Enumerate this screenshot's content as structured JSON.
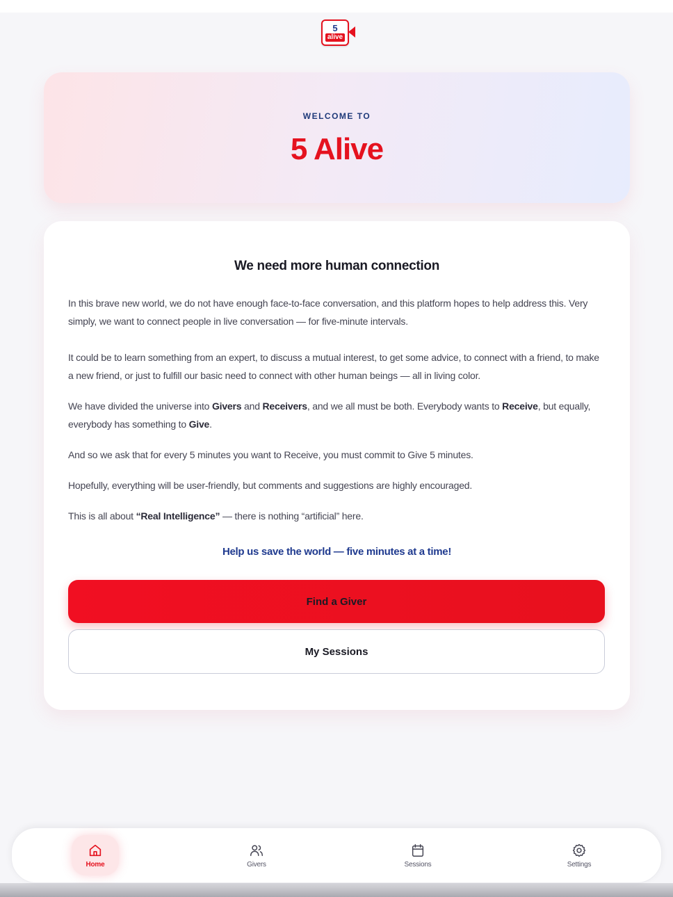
{
  "logo": {
    "number": "5",
    "word": "alive"
  },
  "hero": {
    "eyebrow": "WELCOME TO",
    "title": "5 Alive"
  },
  "card": {
    "heading": "We need more human connection",
    "paragraphs": {
      "p1": "In this brave new world, we do not have enough face-to-face conversation, and this platform hopes to help address this.  Very simply, we want to connect people in live conversation — for five-minute intervals.",
      "p2": "It could be to learn something from an expert, to discuss a mutual interest, to get some advice, to connect with a friend, to make a new friend, or just to fulfill our basic need to connect with other human beings — all in living color.",
      "p3": {
        "a": "We have divided the universe into ",
        "givers": "Givers",
        "b": " and ",
        "receivers": "Receivers",
        "c": ", and we all must be both. Everybody wants to ",
        "receive": "Receive",
        "d": ", but equally, everybody has something to ",
        "give": "Give",
        "e": "."
      },
      "p4": "And so we ask that for every 5 minutes you want to Receive, you must commit to Give 5 minutes.",
      "p5": "Hopefully, everything will be user-friendly, but comments and suggestions are highly encouraged.",
      "p6": {
        "a": "This is all about ",
        "bold": "“Real Intelligence”",
        "b": " — there is nothing “artificial” here."
      }
    },
    "tagline": "Help us save the world — five minutes at a time!",
    "primary_button": "Find a Giver",
    "secondary_button": "My Sessions"
  },
  "nav": {
    "items": [
      {
        "label": "Home",
        "icon": "home-icon",
        "active": true
      },
      {
        "label": "Givers",
        "icon": "users-icon",
        "active": false
      },
      {
        "label": "Sessions",
        "icon": "calendar-icon",
        "active": false
      },
      {
        "label": "Settings",
        "icon": "gear-icon",
        "active": false
      }
    ]
  },
  "colors": {
    "brand_red": "#e5121f",
    "brand_navy": "#1f3a8f"
  }
}
